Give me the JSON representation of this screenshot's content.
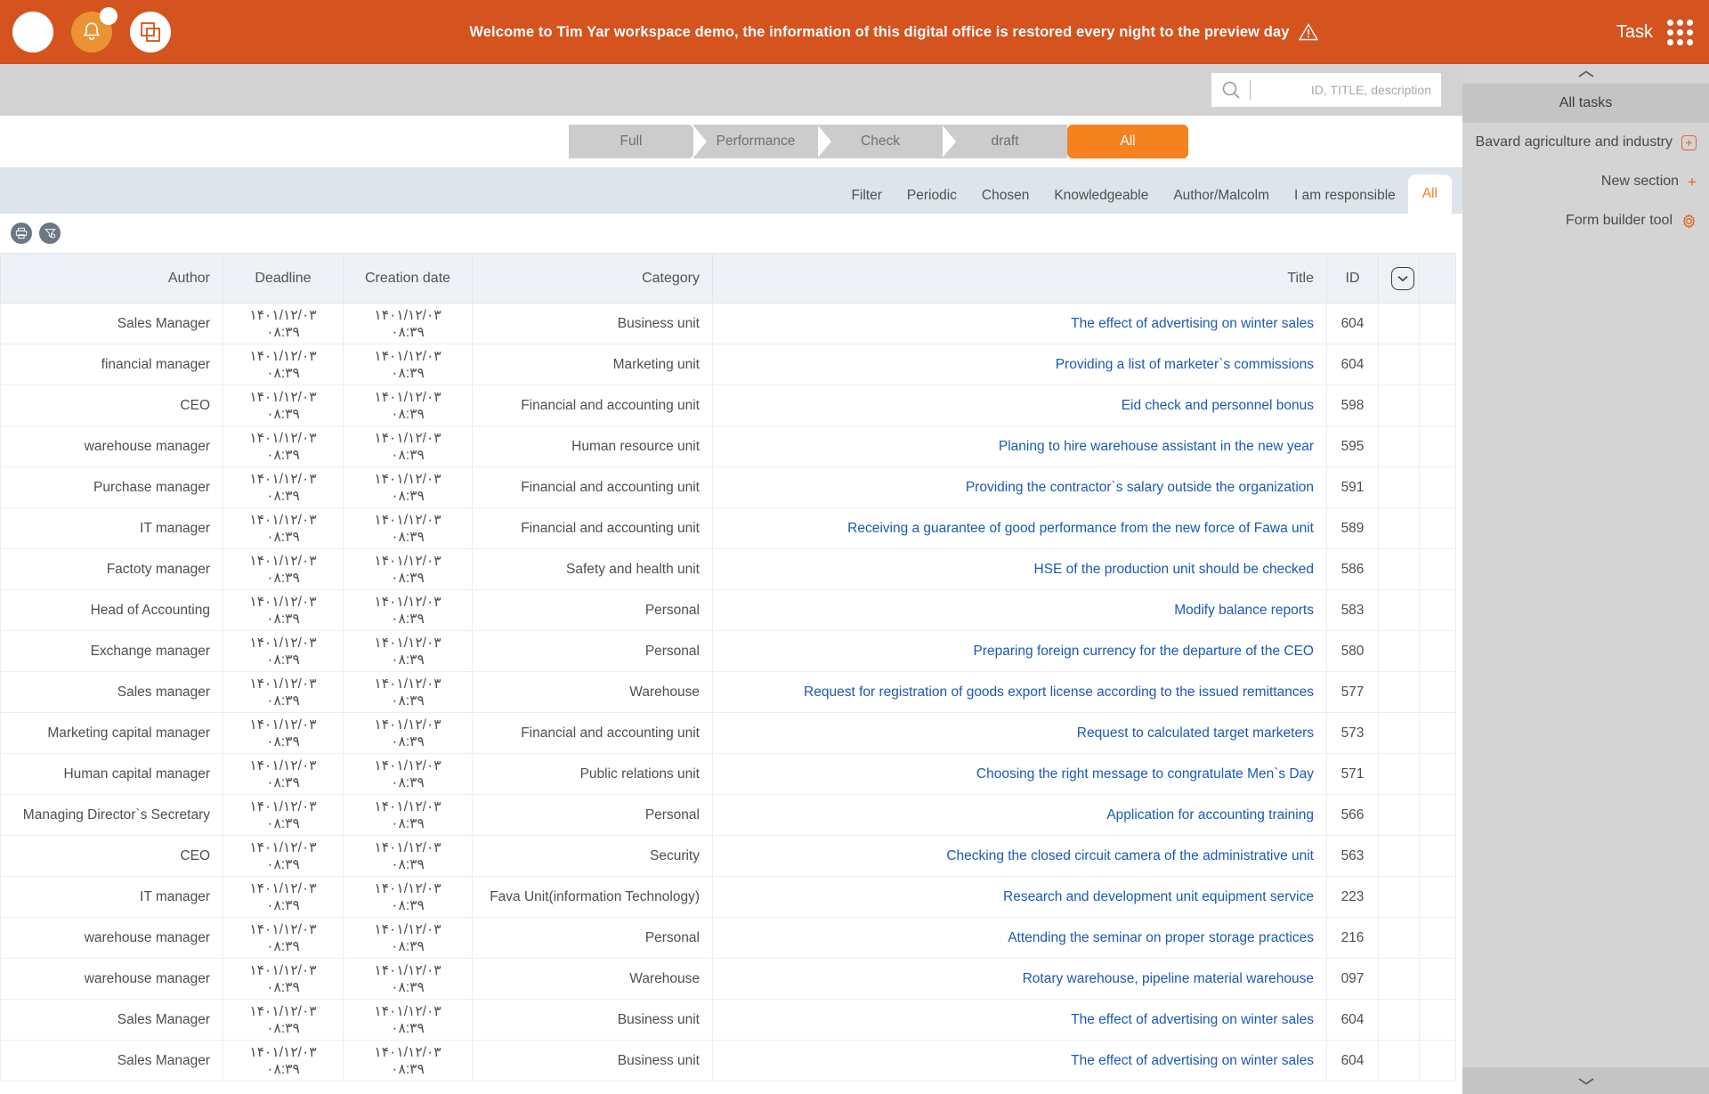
{
  "topbar": {
    "message": "Welcome to Tim Yar workspace demo, the information of this digital office is restored every night to the preview day",
    "badge_count": "",
    "task_label": "Task",
    "avatar_name": "avatar",
    "bell_name": "notification-bell",
    "windows_name": "windows-switch"
  },
  "search": {
    "placeholder": "ID, TITLE, description",
    "value": ""
  },
  "steps": [
    {
      "label": "Full",
      "active": false
    },
    {
      "label": "Performance",
      "active": false
    },
    {
      "label": "Check",
      "active": false
    },
    {
      "label": "draft",
      "active": false
    },
    {
      "label": "All",
      "active": true
    }
  ],
  "tabs": [
    {
      "label": "Filter",
      "active": false
    },
    {
      "label": "Periodic",
      "active": false
    },
    {
      "label": "Chosen",
      "active": false
    },
    {
      "label": "Knowledgeable",
      "active": false
    },
    {
      "label": "Author/Malcolm",
      "active": false
    },
    {
      "label": "I am responsible",
      "active": false
    },
    {
      "label": "All",
      "active": true
    }
  ],
  "toolbar": {
    "print_label": "print",
    "filter_label": "filter-settings"
  },
  "table": {
    "columns": [
      "Author",
      "Deadline",
      "Creation date",
      "Category",
      "Title",
      "ID"
    ],
    "rows": [
      {
        "author": "Sales Manager",
        "deadline": "۱۴۰۱/۱۲/۰۳  ۰۸:۳۹",
        "created": "۱۴۰۱/۱۲/۰۳  ۰۸:۳۹",
        "category": "Business unit",
        "title": "The effect of advertising on winter sales",
        "id": "604"
      },
      {
        "author": "financial manager",
        "deadline": "۱۴۰۱/۱۲/۰۳  ۰۸:۳۹",
        "created": "۱۴۰۱/۱۲/۰۳  ۰۸:۳۹",
        "category": "Marketing unit",
        "title": "Providing a list of marketer`s commissions",
        "id": "604"
      },
      {
        "author": "CEO",
        "deadline": "۱۴۰۱/۱۲/۰۳  ۰۸:۳۹",
        "created": "۱۴۰۱/۱۲/۰۳  ۰۸:۳۹",
        "category": "Financial and accounting unit",
        "title": "Eid check and personnel bonus",
        "id": "598"
      },
      {
        "author": "warehouse manager",
        "deadline": "۱۴۰۱/۱۲/۰۳  ۰۸:۳۹",
        "created": "۱۴۰۱/۱۲/۰۳  ۰۸:۳۹",
        "category": "Human resource unit",
        "title": "Planing to hire warehouse assistant in the new year",
        "id": "595"
      },
      {
        "author": "Purchase manager",
        "deadline": "۱۴۰۱/۱۲/۰۳  ۰۸:۳۹",
        "created": "۱۴۰۱/۱۲/۰۳  ۰۸:۳۹",
        "category": "Financial and accounting unit",
        "title": "Providing the contractor`s salary outside the organization",
        "id": "591"
      },
      {
        "author": "IT manager",
        "deadline": "۱۴۰۱/۱۲/۰۳  ۰۸:۳۹",
        "created": "۱۴۰۱/۱۲/۰۳  ۰۸:۳۹",
        "category": "Financial and accounting unit",
        "title": "Receiving a guarantee of good performance from the new force of Fawa unit",
        "id": "589"
      },
      {
        "author": "Factoty manager",
        "deadline": "۱۴۰۱/۱۲/۰۳  ۰۸:۳۹",
        "created": "۱۴۰۱/۱۲/۰۳  ۰۸:۳۹",
        "category": "Safety and health unit",
        "title": "HSE of the production unit should be checked",
        "id": "586"
      },
      {
        "author": "Head of Accounting",
        "deadline": "۱۴۰۱/۱۲/۰۳  ۰۸:۳۹",
        "created": "۱۴۰۱/۱۲/۰۳  ۰۸:۳۹",
        "category": "Personal",
        "title": "Modify balance reports",
        "id": "583"
      },
      {
        "author": "Exchange manager",
        "deadline": "۱۴۰۱/۱۲/۰۳  ۰۸:۳۹",
        "created": "۱۴۰۱/۱۲/۰۳  ۰۸:۳۹",
        "category": "Personal",
        "title": "Preparing foreign currency for the departure of the CEO",
        "id": "580"
      },
      {
        "author": "Sales manager",
        "deadline": "۱۴۰۱/۱۲/۰۳  ۰۸:۳۹",
        "created": "۱۴۰۱/۱۲/۰۳  ۰۸:۳۹",
        "category": "Warehouse",
        "title": "Request for registration of goods export license according to the issued remittances",
        "id": "577"
      },
      {
        "author": "Marketing capital manager",
        "deadline": "۱۴۰۱/۱۲/۰۳  ۰۸:۳۹",
        "created": "۱۴۰۱/۱۲/۰۳  ۰۸:۳۹",
        "category": "Financial and accounting unit",
        "title": "Request to calculated target marketers",
        "id": "573"
      },
      {
        "author": "Human capital manager",
        "deadline": "۱۴۰۱/۱۲/۰۳  ۰۸:۳۹",
        "created": "۱۴۰۱/۱۲/۰۳  ۰۸:۳۹",
        "category": "Public relations unit",
        "title": "Choosing the right message to congratulate Men`s Day",
        "id": "571"
      },
      {
        "author": "Managing Director`s Secretary",
        "deadline": "۱۴۰۱/۱۲/۰۳  ۰۸:۳۹",
        "created": "۱۴۰۱/۱۲/۰۳  ۰۸:۳۹",
        "category": "Personal",
        "title": "Application for accounting training",
        "id": "566"
      },
      {
        "author": "CEO",
        "deadline": "۱۴۰۱/۱۲/۰۳  ۰۸:۳۹",
        "created": "۱۴۰۱/۱۲/۰۳  ۰۸:۳۹",
        "category": "Security",
        "title": "Checking the closed circuit camera of the administrative unit",
        "id": "563"
      },
      {
        "author": "IT manager",
        "deadline": "۱۴۰۱/۱۲/۰۳  ۰۸:۳۹",
        "created": "۱۴۰۱/۱۲/۰۳  ۰۸:۳۹",
        "category": "Fava Unit(information Technology)",
        "title": "Research and development unit equipment service",
        "id": "223"
      },
      {
        "author": "warehouse manager",
        "deadline": "۱۴۰۱/۱۲/۰۳  ۰۸:۳۹",
        "created": "۱۴۰۱/۱۲/۰۳  ۰۸:۳۹",
        "category": "Personal",
        "title": "Attending the seminar on proper storage practices",
        "id": "216"
      },
      {
        "author": "warehouse manager",
        "deadline": "۱۴۰۱/۱۲/۰۳  ۰۸:۳۹",
        "created": "۱۴۰۱/۱۲/۰۳  ۰۸:۳۹",
        "category": "Warehouse",
        "title": "Rotary warehouse, pipeline material warehouse",
        "id": "097"
      },
      {
        "author": "Sales Manager",
        "deadline": "۱۴۰۱/۱۲/۰۳  ۰۸:۳۹",
        "created": "۱۴۰۱/۱۲/۰۳  ۰۸:۳۹",
        "category": "Business unit",
        "title": "The effect of advertising on winter sales",
        "id": "604"
      },
      {
        "author": "Sales Manager",
        "deadline": "۱۴۰۱/۱۲/۰۳  ۰۸:۳۹",
        "created": "۱۴۰۱/۱۲/۰۳  ۰۸:۳۹",
        "category": "Business unit",
        "title": "The effect of advertising on winter sales",
        "id": "604"
      }
    ]
  },
  "sidebar": {
    "header": "All tasks",
    "items": [
      {
        "label": "Bavard agriculture and industry",
        "icon": "plus-boxed"
      },
      {
        "label": "New section",
        "icon": "plus"
      },
      {
        "label": "Form builder tool",
        "icon": "gear"
      }
    ]
  },
  "colors": {
    "brand_orange": "#d4531f",
    "accent_orange": "#f5821f",
    "link_blue": "#1a5ab5",
    "tab_bar": "#dfe4ea",
    "sidebar_grey": "#d4d4d4"
  }
}
